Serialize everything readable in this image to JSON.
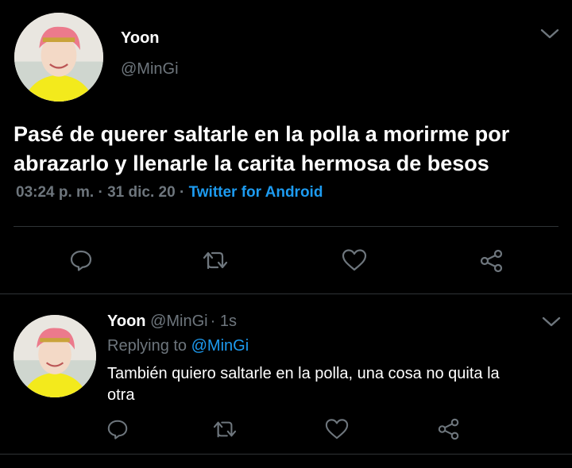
{
  "main_tweet": {
    "display_name": "Yoon",
    "handle": "@MinGi",
    "text_line1": "Pasé de querer saltarle en la polla a morirme por",
    "text_line2": "abrazarlo y llenarle la carita hermosa de besos",
    "time": "03:24 p. m.",
    "sep1": "·",
    "date": "31 dic. 20",
    "sep2": "·",
    "source": "Twitter for Android",
    "actions": [
      "reply-icon",
      "retweet-icon",
      "like-icon",
      "share-icon"
    ]
  },
  "reply_tweet": {
    "display_name": "Yoon",
    "handle": "@MinGi",
    "sep": "·",
    "age": "1s",
    "replying_label": "Replying to",
    "replying_to": "@MinGi",
    "text_line1": "También quiero saltarle en la polla, una cosa no quita la",
    "text_line2": "otra",
    "actions": [
      "reply-icon",
      "retweet-icon",
      "like-icon",
      "share-icon"
    ]
  },
  "colors": {
    "background": "#000000",
    "text": "#ffffff",
    "muted": "#6e767d",
    "link": "#1d9bf0",
    "divider": "#2f3336"
  }
}
